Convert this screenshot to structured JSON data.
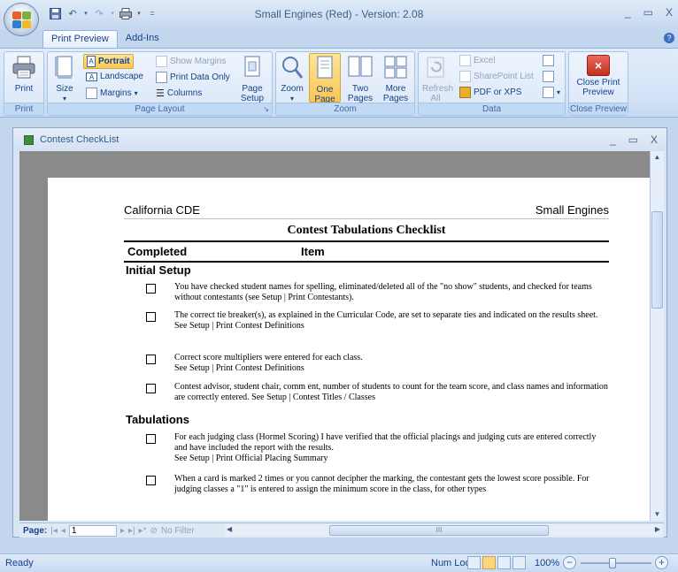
{
  "window": {
    "title": "Small Engines (Red) - Version: 2.08",
    "controls": [
      "_",
      "▭",
      "X"
    ]
  },
  "ribbon": {
    "tabs": [
      "Print Preview",
      "Add-Ins"
    ],
    "print_group": {
      "label": "Print",
      "print_button": "Print"
    },
    "page_layout_group": {
      "label": "Page Layout",
      "size": "Size",
      "portrait": "Portrait",
      "landscape": "Landscape",
      "margins": "Margins",
      "show_margins": "Show Margins",
      "print_data_only": "Print Data Only",
      "columns": "Columns",
      "page_setup": "Page Setup"
    },
    "zoom_group": {
      "label": "Zoom",
      "zoom": "Zoom",
      "one_page": "One Page",
      "two_pages": "Two Pages",
      "more_pages": "More Pages"
    },
    "data_group": {
      "label": "Data",
      "refresh_all": "Refresh All",
      "excel": "Excel",
      "sharepoint_list": "SharePoint List",
      "pdf_or_xps": "PDF or XPS"
    },
    "close_group": {
      "label": "Close Preview",
      "close_button": "Close Print Preview"
    }
  },
  "document": {
    "title": "Contest CheckList",
    "report": {
      "header_left": "California CDE",
      "header_right": "Small Engines",
      "title": "Contest Tabulations Checklist",
      "col_completed": "Completed",
      "col_item": "Item",
      "sections": [
        {
          "name": "Initial Setup",
          "items": [
            "You have checked student names for spelling, eliminated/deleted all of the \"no show\" students, and checked for teams without contestants (see Setup | Print Contestants).",
            "The correct tie breaker(s), as explained in the Curricular Code, are set to separate ties and indicated on the results sheet.\nSee Setup | Print Contest Definitions",
            "Correct score multipliers were entered for each class.\nSee Setup | Print Contest Definitions",
            "Contest advisor, student chair, comm ent, number of students to count for the team score, and class names and information are correctly entered.  See Setup | Contest Titles / Classes"
          ]
        },
        {
          "name": "Tabulations",
          "items": [
            "For each judging class (Hormel Scoring) I have verified that the official placings and judging cuts are entered correctly and have included the report with the results.\nSee Setup | Print Official Placing Summary",
            "When a card is marked 2 times or you cannot decipher the marking, the contestant gets the lowest score possible.  For judging classes a \"1\" is entered to assign the minimum  score in the class, for other types"
          ]
        }
      ]
    },
    "navigation": {
      "page_label": "Page:",
      "page_value": "1",
      "no_filter": "No Filter"
    }
  },
  "statusbar": {
    "ready": "Ready",
    "num_lock": "Num Lock",
    "zoom": "100%"
  }
}
